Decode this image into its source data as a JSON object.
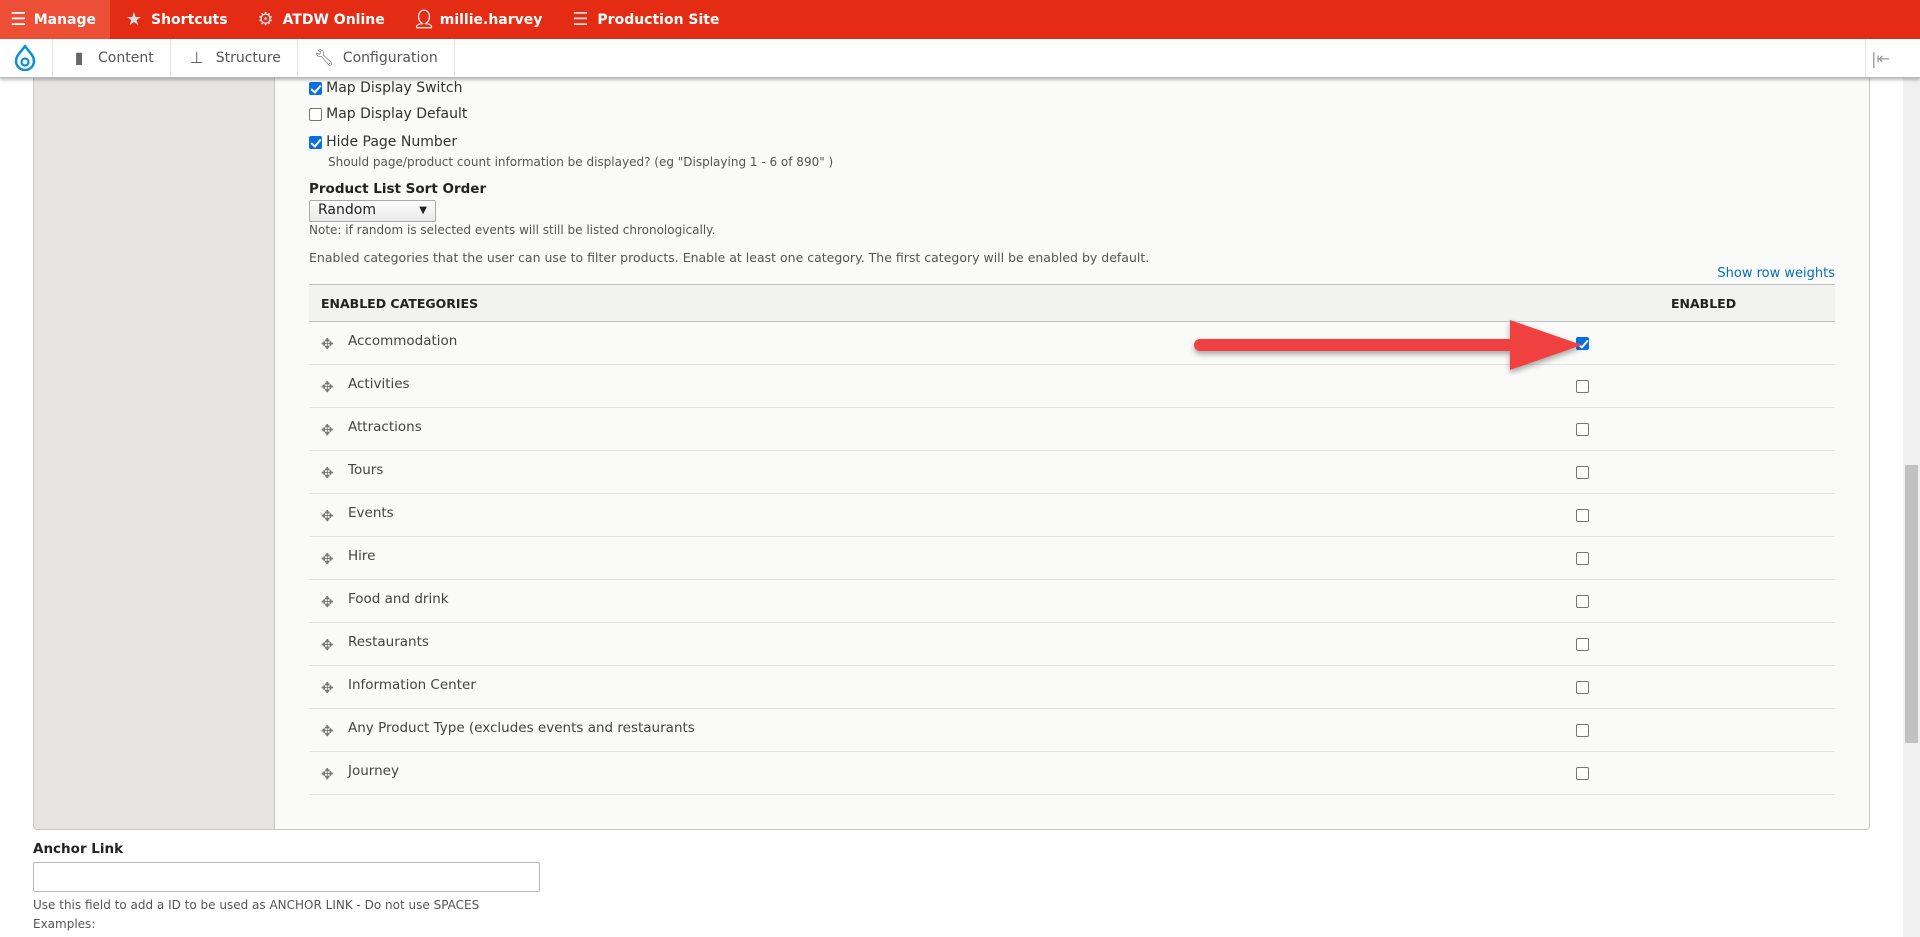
{
  "toolbar": {
    "manage": "Manage",
    "shortcuts": "Shortcuts",
    "atdw": "ATDW Online",
    "user": "millie.harvey",
    "site": "Production Site",
    "color": "#e32c13"
  },
  "subbar": {
    "content": "Content",
    "structure": "Structure",
    "configuration": "Configuration"
  },
  "form": {
    "map_display_switch": {
      "label": "Map Display Switch",
      "checked": true
    },
    "map_display_default": {
      "label": "Map Display Default",
      "checked": false
    },
    "hide_page_number": {
      "label": "Hide Page Number",
      "checked": true,
      "description": "Should page/product count information be displayed? (eg \"Displaying 1 - 6 of 890\" )"
    },
    "sort_order": {
      "label": "Product List Sort Order",
      "value": "Random",
      "note": "Note: if random is selected events will still be listed chronologically."
    },
    "categories_intro": "Enabled categories that the user can use to filter products. Enable at least one category. The first category will be enabled by default.",
    "show_row_weights": "Show row weights",
    "table": {
      "col_category": "ENABLED CATEGORIES",
      "col_enabled": "ENABLED",
      "rows": [
        {
          "name": "Accommodation",
          "enabled": true
        },
        {
          "name": "Activities",
          "enabled": false
        },
        {
          "name": "Attractions",
          "enabled": false
        },
        {
          "name": "Tours",
          "enabled": false
        },
        {
          "name": "Events",
          "enabled": false
        },
        {
          "name": "Hire",
          "enabled": false
        },
        {
          "name": "Food and drink",
          "enabled": false
        },
        {
          "name": "Restaurants",
          "enabled": false
        },
        {
          "name": "Information Center",
          "enabled": false
        },
        {
          "name": "Any Product Type (excludes events and restaurants",
          "enabled": false
        },
        {
          "name": "Journey",
          "enabled": false
        }
      ]
    },
    "anchor": {
      "label": "Anchor Link",
      "value": "",
      "description": "Use this field to add a ID to be used as ANCHOR LINK - Do not use SPACES",
      "examples": "Examples:"
    }
  },
  "annotation": {
    "arrow_color": "#f04040"
  }
}
